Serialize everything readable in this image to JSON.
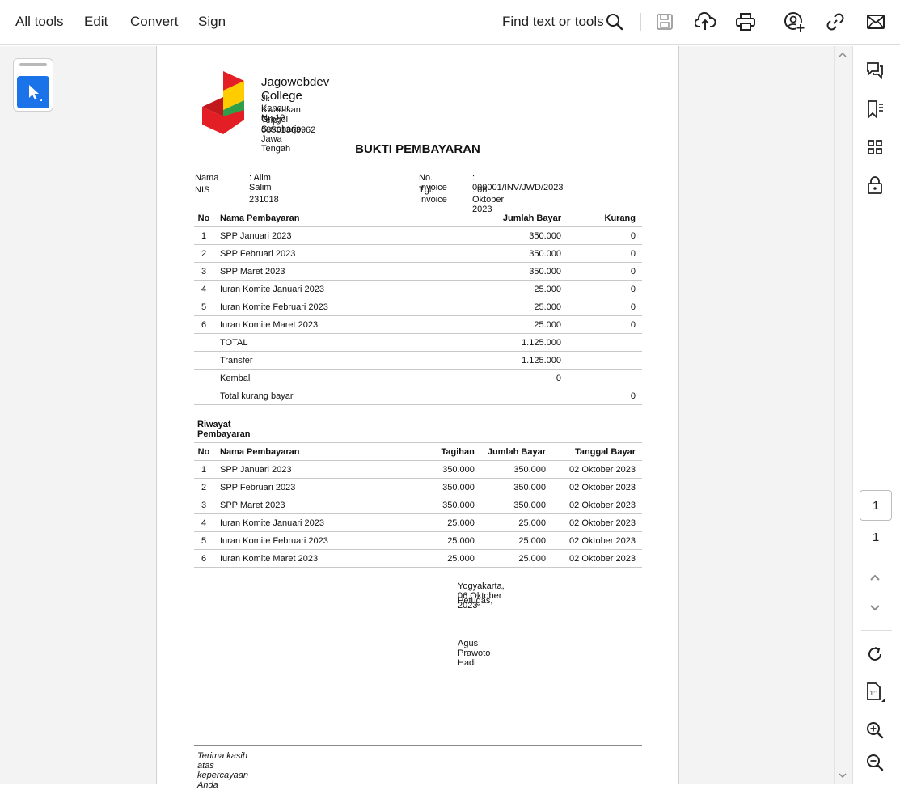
{
  "toolbar": {
    "menu": [
      "All tools",
      "Edit",
      "Convert",
      "Sign"
    ],
    "find_label": "Find text or tools",
    "icons": [
      "search-icon",
      "save-icon",
      "upload-cloud-icon",
      "print-icon",
      "share-user-icon",
      "link-icon",
      "mail-icon"
    ]
  },
  "right_rail": {
    "icons": [
      "comment-icon",
      "bookmark-icon",
      "thumbnails-icon",
      "lock-icon"
    ],
    "page_current": "1",
    "page_total": "1",
    "bottom_icons": [
      "rotate-icon",
      "actual-size-icon",
      "zoom-in-icon",
      "zoom-out-icon"
    ]
  },
  "colors": {
    "accent": "#1a73e8",
    "logo_red": "#e31e24",
    "logo_yellow": "#ffcc00",
    "logo_green": "#2e9e48"
  },
  "invoice": {
    "college": "Jagowebdev College",
    "address": [
      "Jl. Kencur No.19",
      "Kwarasan, Grogol, Sukoharjo, Jawa Tengah",
      "Telp: 08561363962"
    ],
    "title": "BUKTI PEMBAYARAN",
    "nama_label": "Nama",
    "nama_value": ": Alim Salim",
    "nis_label": "NIS",
    "nis_value": ": 231018",
    "inv_no_label": "No. Invoice",
    "inv_no_value": ": 000001/INV/JWD/2023",
    "inv_date_label": "Tgl. Invoice",
    "inv_date_value": ": 06 Oktober 2023",
    "table1": {
      "headers": [
        "No",
        "Nama Pembayaran",
        "Jumlah Bayar",
        "Kurang"
      ],
      "rows": [
        [
          "1",
          "SPP Januari 2023",
          "350.000",
          "0"
        ],
        [
          "2",
          "SPP Februari 2023",
          "350.000",
          "0"
        ],
        [
          "3",
          "SPP Maret 2023",
          "350.000",
          "0"
        ],
        [
          "4",
          "Iuran Komite Januari 2023",
          "25.000",
          "0"
        ],
        [
          "5",
          "Iuran Komite Februari 2023",
          "25.000",
          "0"
        ],
        [
          "6",
          "Iuran Komite Maret 2023",
          "25.000",
          "0"
        ]
      ],
      "summary": [
        [
          "TOTAL",
          "1.125.000",
          ""
        ],
        [
          "Transfer",
          "1.125.000",
          ""
        ],
        [
          "Kembali",
          "0",
          ""
        ],
        [
          "Total kurang bayar",
          "",
          "0"
        ]
      ]
    },
    "history_title": "Riwayat Pembayaran",
    "table2": {
      "headers": [
        "No",
        "Nama Pembayaran",
        "Tagihan",
        "Jumlah Bayar",
        "Tanggal Bayar"
      ],
      "rows": [
        [
          "1",
          "SPP Januari 2023",
          "350.000",
          "350.000",
          "02 Oktober 2023"
        ],
        [
          "2",
          "SPP Februari 2023",
          "350.000",
          "350.000",
          "02 Oktober 2023"
        ],
        [
          "3",
          "SPP Maret 2023",
          "350.000",
          "350.000",
          "02 Oktober 2023"
        ],
        [
          "4",
          "Iuran Komite Januari 2023",
          "25.000",
          "25.000",
          "02 Oktober 2023"
        ],
        [
          "5",
          "Iuran Komite Februari 2023",
          "25.000",
          "25.000",
          "02 Oktober 2023"
        ],
        [
          "6",
          "Iuran Komite Maret 2023",
          "25.000",
          "25.000",
          "02 Oktober 2023"
        ]
      ]
    },
    "sign_place_date": "Yogyakarta, 06 Oktober 2023",
    "sign_role": "Petugas,",
    "sign_name": "Agus Prawoto Hadi",
    "footer": "Terima kasih atas kepercayaan Anda"
  }
}
